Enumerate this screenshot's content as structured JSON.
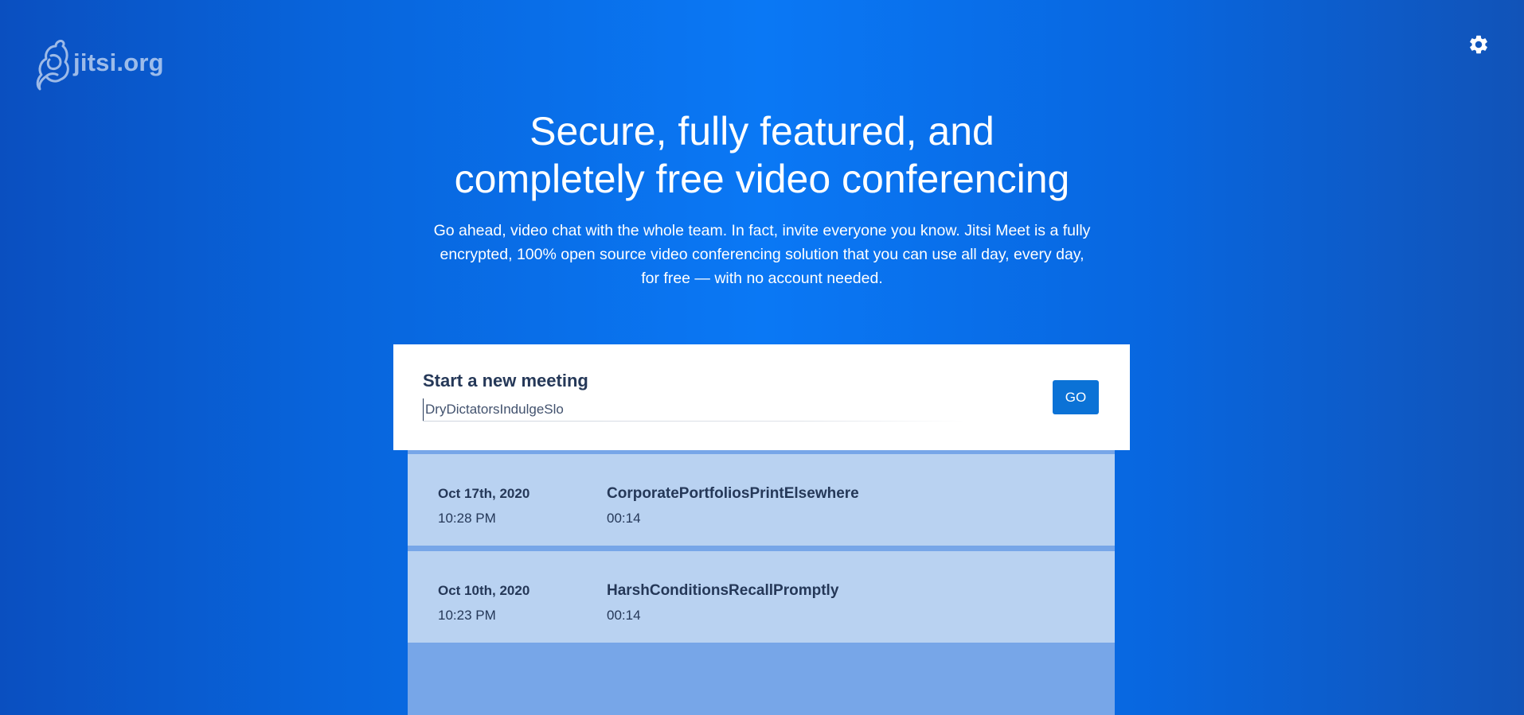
{
  "brand": {
    "logo_text": "jitsi.org"
  },
  "header": {
    "settings_icon": "gear-icon"
  },
  "hero": {
    "title_line1": "Secure, fully featured, and",
    "title_line2": "completely free video conferencing",
    "description": "Go ahead, video chat with the whole team. In fact, invite everyone you know. Jitsi Meet is a fully encrypted, 100% open source video conferencing solution that you can use all day, every day, for free — with no account needed."
  },
  "meeting": {
    "title": "Start a new meeting",
    "input_value": "DryDictatorsIndulgeSlo",
    "go_label": "GO"
  },
  "recent_meetings": [
    {
      "date": "Oct 17th, 2020",
      "time": "10:28 PM",
      "room": "CorporatePortfoliosPrintElsewhere",
      "duration": "00:14"
    },
    {
      "date": "Oct 10th, 2020",
      "time": "10:23 PM",
      "room": "HarshConditionsRecallPromptly",
      "duration": "00:14"
    }
  ],
  "colors": {
    "accent": "#0b72d6",
    "card_text": "#253858",
    "list_item": "#b9d2f1",
    "list_background": "#77a6e8"
  }
}
